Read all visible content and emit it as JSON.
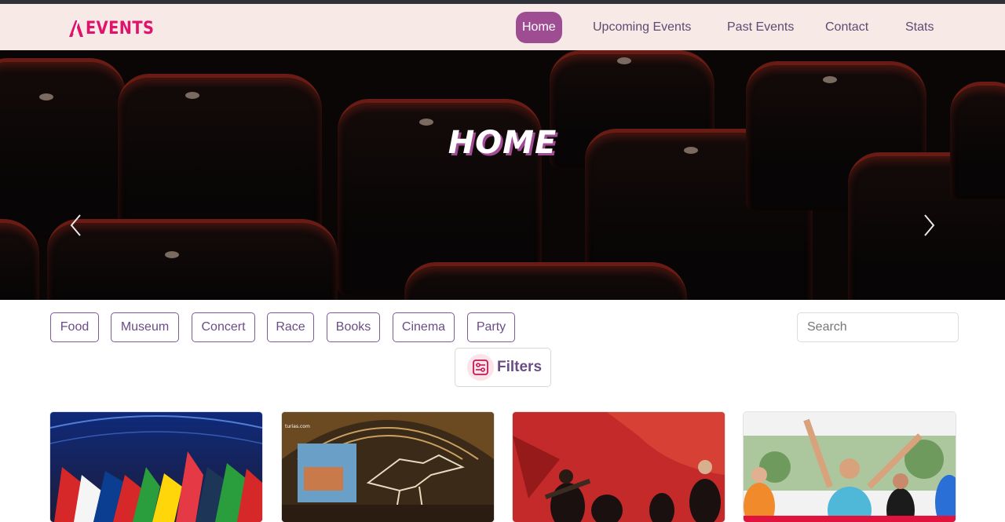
{
  "nav": {
    "logo_text": "EVENTS",
    "brand_color": "#e0136c",
    "active_color": "#9f4d93",
    "links": [
      {
        "label": "Home",
        "active": true
      },
      {
        "label": "Upcoming Events",
        "active": false
      },
      {
        "label": "Past Events",
        "active": false
      },
      {
        "label": "Contact",
        "active": false
      },
      {
        "label": "Stats",
        "active": false
      }
    ]
  },
  "hero": {
    "title": "HOME",
    "prev_icon": "chevron-left-icon",
    "next_icon": "chevron-right-icon"
  },
  "categories": [
    "Food",
    "Museum",
    "Concert",
    "Race",
    "Books",
    "Cinema",
    "Party"
  ],
  "search": {
    "placeholder": "Search",
    "value": ""
  },
  "filters": {
    "label": "Filters",
    "icon": "sliders-icon"
  },
  "cards": [
    {
      "image": "flags-ceremony-photo"
    },
    {
      "image": "dinosaur-museum-photo"
    },
    {
      "image": "rock-concert-photo"
    },
    {
      "image": "marathon-runners-photo"
    }
  ]
}
